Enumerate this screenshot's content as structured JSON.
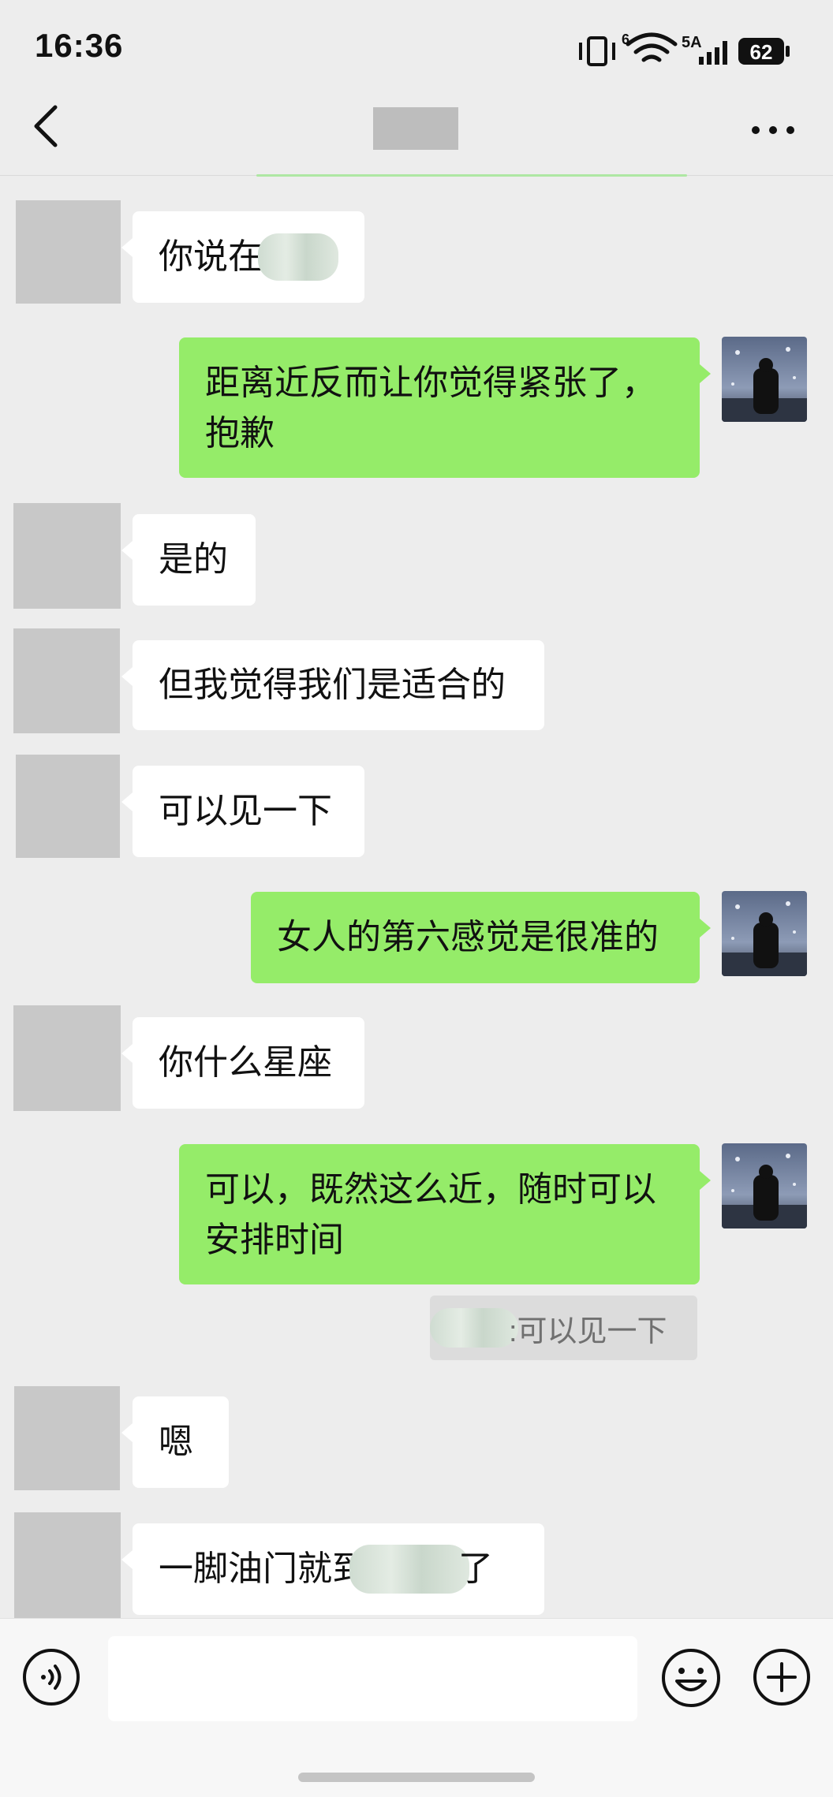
{
  "status_bar": {
    "time": "16:36",
    "network_6": "6",
    "network_5a": "5A",
    "battery": "62"
  },
  "header": {
    "title_hidden": true,
    "back_icon": "chevron-left-icon",
    "more_icon": "more-dots-icon"
  },
  "messages": [
    {
      "side": "left",
      "text_prefix": "你说在",
      "redacted": true
    },
    {
      "side": "right",
      "line1": "距离近反而让你觉得紧张了，",
      "line2": "抱歉"
    },
    {
      "side": "left",
      "text": "是的"
    },
    {
      "side": "left",
      "text": "但我觉得我们是适合的"
    },
    {
      "side": "left",
      "text": "可以见一下"
    },
    {
      "side": "right",
      "text": "女人的第六感觉是很准的"
    },
    {
      "side": "left",
      "text": "你什么星座"
    },
    {
      "side": "right",
      "line1": "可以，既然这么近，随时可以",
      "line2": "安排时间"
    },
    {
      "side": "left",
      "text": "嗯"
    },
    {
      "side": "left",
      "text_prefix": "一脚油门就到",
      "text_suffix": "了",
      "redacted": true
    }
  ],
  "quote": {
    "text": ":可以见一下"
  },
  "input_bar": {
    "voice_icon": "voice-icon",
    "emoji_icon": "emoji-icon",
    "plus_icon": "plus-icon",
    "input_value": ""
  },
  "colors": {
    "background": "#ededed",
    "bubble_self": "#95ec69",
    "bubble_other": "#ffffff"
  }
}
